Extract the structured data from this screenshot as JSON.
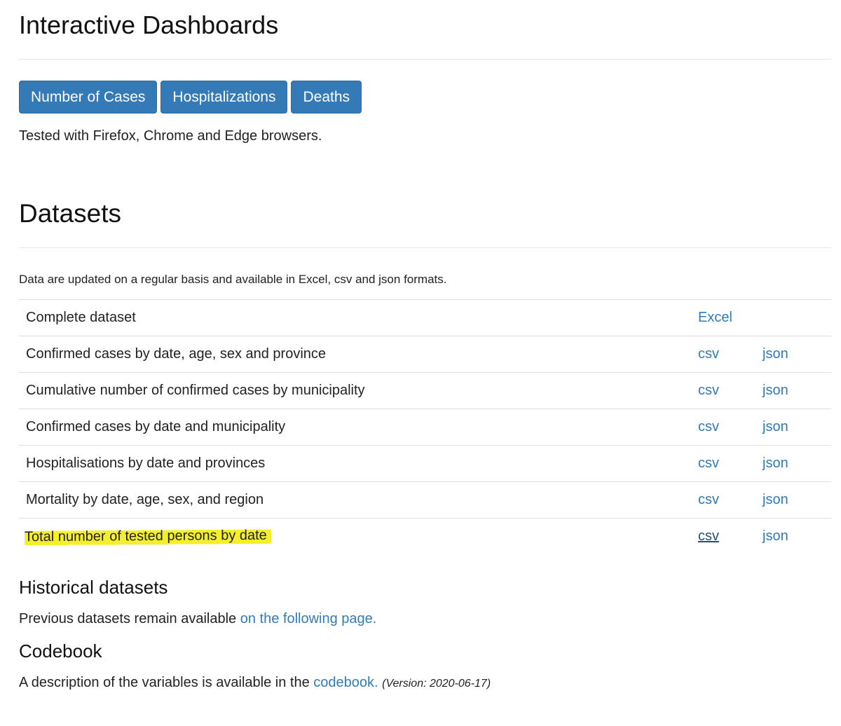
{
  "dashboards": {
    "title": "Interactive Dashboards",
    "buttons": [
      {
        "label": "Number of Cases"
      },
      {
        "label": "Hospitalizations"
      },
      {
        "label": "Deaths"
      }
    ],
    "note": "Tested with Firefox, Chrome and Edge browsers."
  },
  "datasets": {
    "title": "Datasets",
    "intro": "Data are updated on a regular basis and available in Excel, csv and json formats.",
    "rows": [
      {
        "label": "Complete dataset",
        "link1": "Excel",
        "link2": ""
      },
      {
        "label": "Confirmed cases by date, age, sex and province",
        "link1": "csv",
        "link2": "json"
      },
      {
        "label": "Cumulative number of confirmed cases by municipality",
        "link1": "csv",
        "link2": "json"
      },
      {
        "label": "Confirmed cases by date and municipality",
        "link1": "csv",
        "link2": "json"
      },
      {
        "label": "Hospitalisations by date and provinces",
        "link1": "csv",
        "link2": "json"
      },
      {
        "label": "Mortality by date, age, sex, and region",
        "link1": "csv",
        "link2": "json"
      },
      {
        "label": "Total number of tested persons by date",
        "link1": "csv",
        "link2": "json",
        "highlighted": true,
        "link1_visited": true
      }
    ]
  },
  "historical": {
    "title": "Historical datasets",
    "text": "Previous datasets remain available ",
    "link": "on the following page."
  },
  "codebook": {
    "title": "Codebook",
    "text": "A description of the variables is available in the ",
    "link": "codebook.",
    "version": "(Version: 2020-06-17)"
  },
  "colors": {
    "button_bg": "#337ab7",
    "link": "#337ab7",
    "highlight": "#f4ef2a"
  }
}
